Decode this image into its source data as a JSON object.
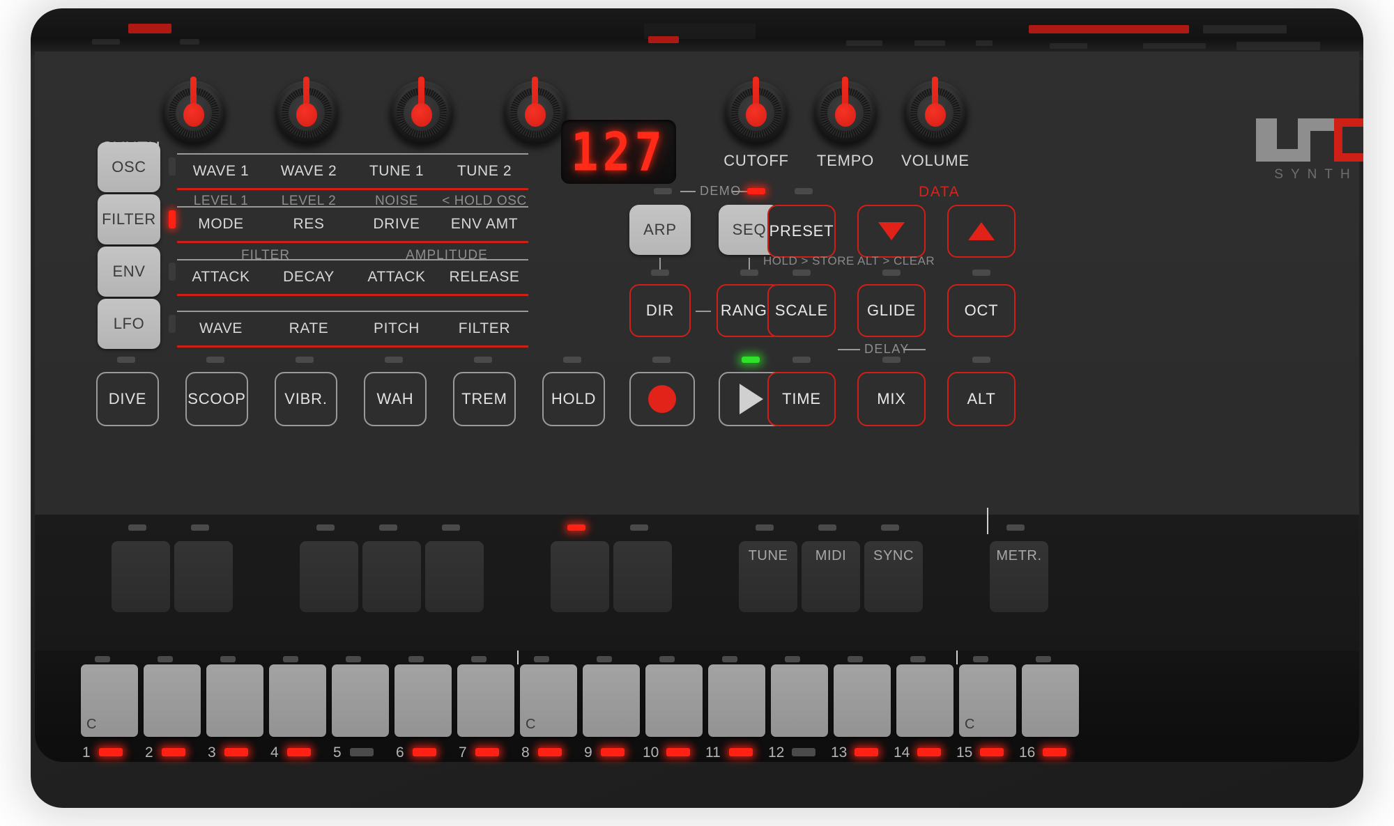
{
  "device": {
    "name": "UNO SYNTH",
    "brand_mark": "UNO",
    "brand_sub": "SYNTH"
  },
  "display": {
    "value": "127"
  },
  "synth_label": "SYNTH",
  "knobs_left": [
    {
      "name": "WAVE 1",
      "label": "WAVE 1"
    },
    {
      "name": "WAVE 2",
      "label": "WAVE 2"
    },
    {
      "name": "TUNE 1",
      "label": "TUNE 1"
    },
    {
      "name": "TUNE 2",
      "label": "TUNE 2"
    }
  ],
  "knobs_right": [
    {
      "label": "CUTOFF"
    },
    {
      "label": "TEMPO"
    },
    {
      "label": "VOLUME"
    }
  ],
  "section_buttons": [
    {
      "label": "OSC",
      "led": "off"
    },
    {
      "label": "FILTER",
      "led": "on"
    },
    {
      "label": "ENV",
      "led": "off"
    },
    {
      "label": "LFO",
      "led": "off"
    }
  ],
  "param_rows": [
    {
      "id": "osc",
      "primary": [
        "WAVE 1",
        "WAVE 2",
        "TUNE 1",
        "TUNE 2"
      ],
      "secondary": [
        "LEVEL 1",
        "LEVEL 2",
        "NOISE",
        "< HOLD OSC"
      ],
      "group_labels": []
    },
    {
      "id": "filter",
      "primary": [
        "MODE",
        "RES",
        "DRIVE",
        "ENV AMT"
      ],
      "secondary": [],
      "group_labels": []
    },
    {
      "id": "env",
      "primary": [
        "ATTACK",
        "DECAY",
        "ATTACK",
        "RELEASE"
      ],
      "secondary": [],
      "group_labels": [
        "FILTER",
        "AMPLITUDE"
      ]
    },
    {
      "id": "lfo",
      "primary": [
        "WAVE",
        "RATE",
        "PITCH",
        "FILTER"
      ],
      "secondary": [],
      "group_labels": []
    }
  ],
  "demo": {
    "label": "DEMO",
    "led_left": "off",
    "led_right": "on"
  },
  "data_section": {
    "label": "DATA",
    "down_icon": "triangle-down-icon",
    "up_icon": "triangle-up-icon"
  },
  "delay_section": {
    "label": "DELAY"
  },
  "mode_buttons": [
    {
      "label": "ARP",
      "style": "solid",
      "led": "off"
    },
    {
      "label": "SEQ",
      "style": "solid",
      "led": "off"
    },
    {
      "label": "PRESET",
      "style": "outline-red",
      "led": "off",
      "note": "HOLD > STORE"
    }
  ],
  "data_buttons": [
    {
      "label": "",
      "icon": "triangle-down-icon",
      "style": "outline-red",
      "note": "ALT > CLEAR"
    },
    {
      "label": "",
      "icon": "triangle-up-icon",
      "style": "outline-red",
      "note": ""
    }
  ],
  "function_row": [
    {
      "label": "DIR",
      "style": "outline-red",
      "led": "off"
    },
    {
      "label": "RANGE",
      "style": "outline-red",
      "led": "off"
    },
    {
      "label": "SCALE",
      "style": "outline-red",
      "led": "off"
    },
    {
      "label": "GLIDE",
      "style": "outline-red",
      "led": "off"
    },
    {
      "label": "OCT",
      "style": "outline-red",
      "led": "off"
    }
  ],
  "bottom_row": [
    {
      "label": "DIVE",
      "style": "outline-grey",
      "led": "off"
    },
    {
      "label": "SCOOP",
      "style": "outline-grey",
      "led": "off"
    },
    {
      "label": "VIBR.",
      "style": "outline-grey",
      "led": "off"
    },
    {
      "label": "WAH",
      "style": "outline-grey",
      "led": "off"
    },
    {
      "label": "TREM",
      "style": "outline-grey",
      "led": "off"
    },
    {
      "label": "HOLD",
      "style": "outline-grey",
      "led": "off"
    },
    {
      "label": "",
      "style": "outline-grey",
      "led": "off",
      "icon": "record-icon"
    },
    {
      "label": "",
      "style": "outline-grey",
      "led": "on-green",
      "icon": "play-icon"
    },
    {
      "label": "TIME",
      "style": "outline-red",
      "led": "off"
    },
    {
      "label": "MIX",
      "style": "outline-red",
      "led": "off"
    },
    {
      "label": "ALT",
      "style": "outline-red",
      "led": "off"
    }
  ],
  "pads": [
    {
      "label": "",
      "led": "off"
    },
    {
      "label": "",
      "led": "off"
    },
    {
      "label": "",
      "led": "off"
    },
    {
      "label": "",
      "led": "off"
    },
    {
      "label": "",
      "led": "off"
    },
    {
      "label": "",
      "led": "on"
    },
    {
      "label": "",
      "led": "off"
    },
    {
      "label": "TUNE",
      "led": "off"
    },
    {
      "label": "MIDI",
      "led": "off"
    },
    {
      "label": "SYNC",
      "led": "off"
    },
    {
      "label": "METR.",
      "led": "off"
    }
  ],
  "keys": [
    {
      "step": "1",
      "note": "C",
      "led": "on"
    },
    {
      "step": "2",
      "note": "",
      "led": "on"
    },
    {
      "step": "3",
      "note": "",
      "led": "on"
    },
    {
      "step": "4",
      "note": "",
      "led": "on"
    },
    {
      "step": "5",
      "note": "",
      "led": "off"
    },
    {
      "step": "6",
      "note": "",
      "led": "on"
    },
    {
      "step": "7",
      "note": "",
      "led": "on"
    },
    {
      "step": "8",
      "note": "C",
      "led": "on"
    },
    {
      "step": "9",
      "note": "",
      "led": "on"
    },
    {
      "step": "10",
      "note": "",
      "led": "on"
    },
    {
      "step": "11",
      "note": "",
      "led": "on"
    },
    {
      "step": "12",
      "note": "",
      "led": "off"
    },
    {
      "step": "13",
      "note": "",
      "led": "on"
    },
    {
      "step": "14",
      "note": "",
      "led": "on"
    },
    {
      "step": "15",
      "note": "C",
      "led": "on"
    },
    {
      "step": "16",
      "note": "",
      "led": "on"
    }
  ],
  "colors": {
    "accent_red": "#cf2017",
    "led_red": "#ff2214",
    "led_green": "#2ee22a",
    "panel": "#2c2c2c",
    "button_grey": "#b8b8b8"
  }
}
